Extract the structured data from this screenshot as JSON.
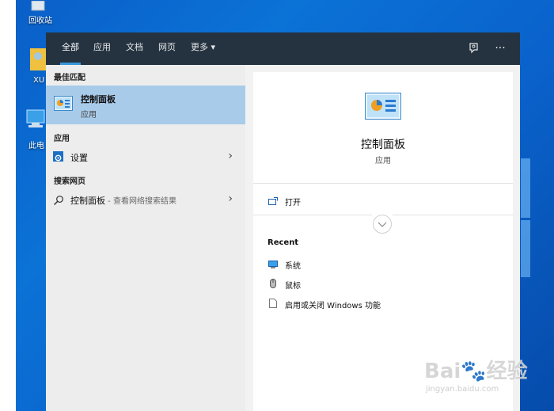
{
  "desktop": {
    "icons": [
      {
        "name": "recycle-bin",
        "label": "回收站"
      },
      {
        "name": "user-folder",
        "label": "XU"
      },
      {
        "name": "this-pc",
        "label": "此电"
      }
    ]
  },
  "search": {
    "tabs": [
      {
        "label": "全部",
        "active": true
      },
      {
        "label": "应用"
      },
      {
        "label": "文档"
      },
      {
        "label": "网页"
      },
      {
        "label": "更多 ▾"
      }
    ],
    "top_icons": [
      "feedback-icon",
      "more-options-icon"
    ],
    "more_glyph": "···"
  },
  "results": {
    "best_match_heading": "最佳匹配",
    "best_match": {
      "title": "控制面板",
      "subtitle": "应用"
    },
    "apps_heading": "应用",
    "apps": [
      {
        "label": "设置"
      }
    ],
    "web_heading": "搜索网页",
    "web": [
      {
        "label": "控制面板",
        "suffix": " - 查看网络搜索结果"
      }
    ],
    "chevron": "›"
  },
  "detail": {
    "title": "控制面板",
    "subtitle": "应用",
    "actions": [
      {
        "label": "打开"
      }
    ],
    "recent_heading": "Recent",
    "recent": [
      {
        "label": "系统",
        "icon": "system-icon"
      },
      {
        "label": "鼠标",
        "icon": "mouse-icon"
      },
      {
        "label": "启用或关闭 Windows 功能",
        "icon": "document-icon"
      }
    ]
  },
  "watermark": {
    "main": "Bai🐾经验",
    "sub": "jingyan.baidu.com"
  }
}
